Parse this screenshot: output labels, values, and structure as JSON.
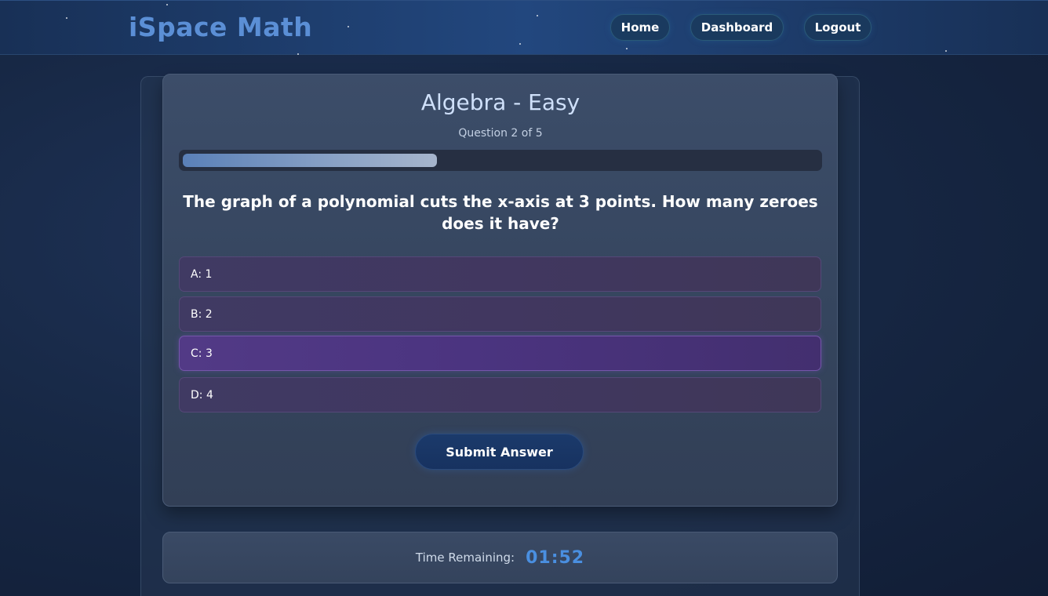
{
  "header": {
    "logo": "iSpace Math",
    "nav": [
      {
        "label": "Home"
      },
      {
        "label": "Dashboard"
      },
      {
        "label": "Logout"
      }
    ]
  },
  "quiz": {
    "title": "Algebra - Easy",
    "counter": "Question 2 of 5",
    "progress_fraction": 0.4,
    "question": "The graph of a polynomial cuts the x-axis at 3 points. How many zeroes does it have?",
    "options": [
      {
        "label": "A: 1",
        "selected": false
      },
      {
        "label": "B: 2",
        "selected": false
      },
      {
        "label": "C: 3",
        "selected": true
      },
      {
        "label": "D: 4",
        "selected": false
      }
    ],
    "submit_label": "Submit Answer"
  },
  "timer": {
    "label": "Time Remaining:",
    "value": "01:52"
  },
  "colors": {
    "accent": "#4a8fe0",
    "logo": "#5b8fd6",
    "selected_option": "#523a86"
  }
}
